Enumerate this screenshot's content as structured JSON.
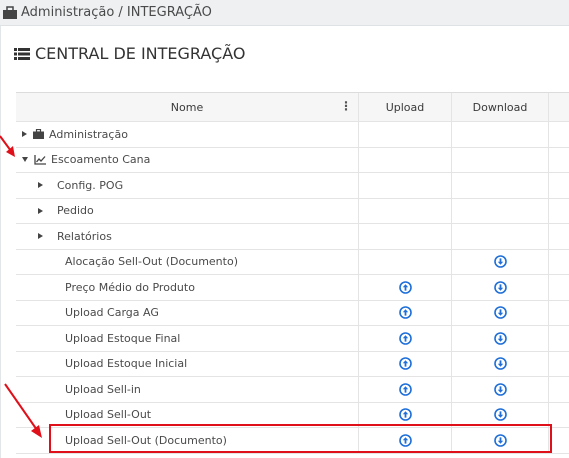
{
  "breadcrumb": {
    "text": "Administração / INTEGRAÇÃO"
  },
  "page": {
    "title": "CENTRAL DE INTEGRAÇÃO"
  },
  "table": {
    "headers": {
      "name": "Nome",
      "upload": "Upload",
      "download": "Download"
    },
    "rows": [
      {
        "label": "Administração",
        "level": 0,
        "toggle": "collapsed",
        "icon": "briefcase-icon",
        "upload": false,
        "download": false
      },
      {
        "label": "Escoamento Cana",
        "level": 0,
        "toggle": "expanded",
        "icon": "line-chart-icon",
        "upload": false,
        "download": false
      },
      {
        "label": "Config. POG",
        "level": 1,
        "toggle": "collapsed",
        "upload": false,
        "download": false
      },
      {
        "label": "Pedido",
        "level": 1,
        "toggle": "collapsed",
        "upload": false,
        "download": false
      },
      {
        "label": "Relatórios",
        "level": 1,
        "toggle": "collapsed",
        "upload": false,
        "download": false
      },
      {
        "label": "Alocação Sell-Out (Documento)",
        "level": 2,
        "toggle": "none",
        "upload": false,
        "download": true
      },
      {
        "label": "Preço Médio do Produto",
        "level": 2,
        "toggle": "none",
        "upload": true,
        "download": true
      },
      {
        "label": "Upload Carga AG",
        "level": 2,
        "toggle": "none",
        "upload": true,
        "download": true
      },
      {
        "label": "Upload Estoque Final",
        "level": 2,
        "toggle": "none",
        "upload": true,
        "download": true
      },
      {
        "label": "Upload Estoque Inicial",
        "level": 2,
        "toggle": "none",
        "upload": true,
        "download": true
      },
      {
        "label": "Upload Sell-in",
        "level": 2,
        "toggle": "none",
        "upload": true,
        "download": true
      },
      {
        "label": "Upload Sell-Out",
        "level": 2,
        "toggle": "none",
        "upload": true,
        "download": true
      },
      {
        "label": "Upload Sell-Out (Documento)",
        "level": 2,
        "toggle": "none",
        "upload": true,
        "download": true,
        "highlighted": true
      }
    ]
  },
  "colors": {
    "accent_blue": "#1e6fd9",
    "highlight_red": "#e0101a"
  }
}
